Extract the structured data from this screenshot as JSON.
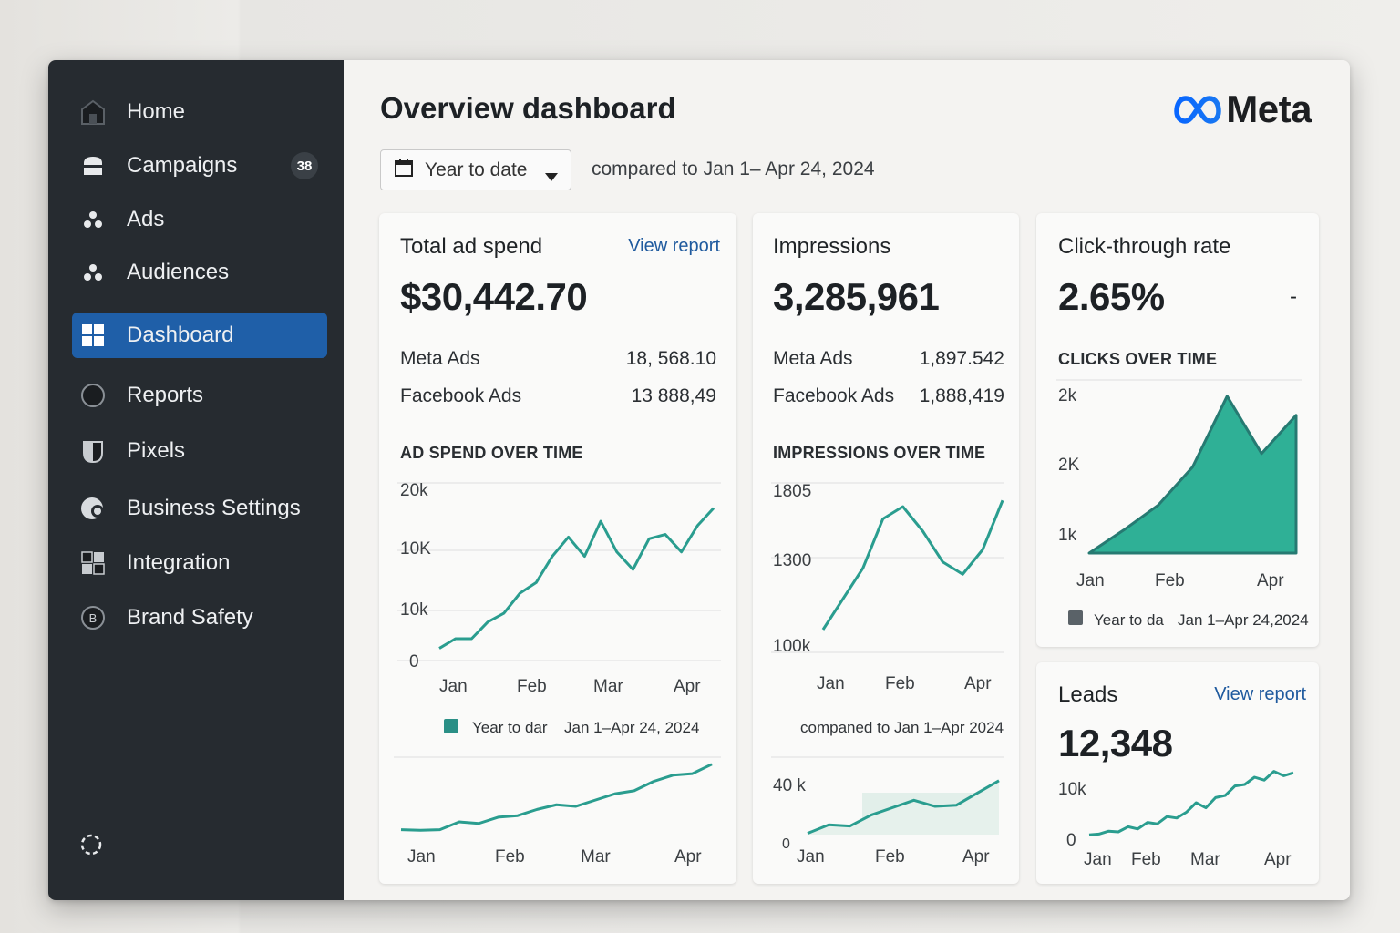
{
  "sidebar": {
    "items": [
      {
        "label": "Home",
        "icon": "home-icon"
      },
      {
        "label": "Campaigns",
        "icon": "campaigns-icon",
        "badge": "38"
      },
      {
        "label": "Ads",
        "icon": "ads-icon"
      },
      {
        "label": "Audiences",
        "icon": "audiences-icon"
      },
      {
        "label": "Dashboard",
        "icon": "dashboard-icon",
        "active": true
      },
      {
        "label": "Reports",
        "icon": "reports-icon"
      },
      {
        "label": "Pixels",
        "icon": "pixels-icon"
      },
      {
        "label": "Business Settings",
        "icon": "business-settings-icon"
      },
      {
        "label": "Integration",
        "icon": "integration-icon"
      },
      {
        "label": "Brand Safety",
        "icon": "brand-safety-icon"
      }
    ],
    "bottom_icon": "loading-icon"
  },
  "header": {
    "title": "Overview dashboard",
    "logo_text": "Meta",
    "date_select": "Year to date",
    "compare_text": "compared to Jan 1– Apr 24, 2024"
  },
  "colors": {
    "accent": "#2a9d8f",
    "sidebar_bg": "#262b30",
    "active_item": "#1f5fa8",
    "link": "#1f5a9e"
  },
  "cards": {
    "spend": {
      "title": "Total ad spend",
      "link": "View report",
      "value": "$30,442.70",
      "rows": [
        {
          "label": "Meta Ads",
          "value": "18, 568.10"
        },
        {
          "label": "Facebook Ads",
          "value": "13 888,49"
        }
      ],
      "chart_title": "AD SPEND OVER TIME",
      "legend_a": "Year to dar",
      "legend_b": "Jan 1–Apr 24, 2024"
    },
    "impressions": {
      "title": "Impressions",
      "value": "3,285,961",
      "rows": [
        {
          "label": "Meta Ads",
          "value": "1,897.542"
        },
        {
          "label": "Facebook Ads",
          "value": "1,888,419"
        }
      ],
      "chart_title": "IMPRESSIONS OVER TIME",
      "compare_note": "companed to Jan 1–Apr 2024"
    },
    "ctr": {
      "title": "Click-through rate",
      "value": "2.65%",
      "dash": "-",
      "chart_title": "CLICKS OVER TIME",
      "legend_a": "Year to da",
      "legend_b": "Jan 1–Apr 24,2024"
    },
    "leads": {
      "title": "Leads",
      "link": "View report",
      "value": "12,348"
    }
  },
  "chart_data": [
    {
      "type": "line",
      "title": "AD SPEND OVER TIME",
      "y_tick_labels": [
        "20k",
        "10K",
        "10k",
        "0"
      ],
      "x_tick_labels": [
        "Jan",
        "Feb",
        "Mar",
        "Apr"
      ],
      "series": [
        {
          "name": "Year to dar",
          "values": [
            1.5,
            2.6,
            2.6,
            4.5,
            5.5,
            7.8,
            9.0,
            12.0,
            14.2,
            12.0,
            16.0,
            12.5,
            10.5,
            14.0,
            14.5,
            12.5,
            15.5,
            17.5
          ]
        }
      ],
      "ylim": [
        0,
        21
      ]
    },
    {
      "type": "line",
      "title": "",
      "x_tick_labels": [
        "Jan",
        "Feb",
        "Mar",
        "Apr"
      ],
      "series": [
        {
          "values": [
            1.0,
            0.8,
            1.0,
            3.5,
            3.0,
            5.0,
            5.5,
            7.5,
            9.0,
            8.5,
            10.5,
            12.5,
            13.5,
            16.5,
            18.5,
            19.0,
            22.0
          ]
        }
      ],
      "ylim": [
        0,
        24
      ]
    },
    {
      "type": "line",
      "title": "IMPRESSIONS OVER TIME",
      "y_tick_labels": [
        "1805",
        "1300",
        "100k"
      ],
      "x_tick_labels": [
        "Jan",
        "Feb",
        "Apr"
      ],
      "series": [
        {
          "values": [
            2.0,
            4.5,
            7.0,
            11.0,
            12.0,
            10.0,
            7.5,
            6.5,
            8.5,
            12.5
          ]
        }
      ],
      "ylim": [
        0,
        16
      ]
    },
    {
      "type": "area",
      "title": "",
      "y_tick_labels": [
        "40 k",
        "0"
      ],
      "x_tick_labels": [
        "Jan",
        "Feb",
        "Apr"
      ],
      "series": [
        {
          "values": [
            0.5,
            4,
            3.5,
            8,
            11,
            14,
            11.5,
            12,
            17,
            22
          ]
        }
      ],
      "ylim": [
        0,
        26
      ]
    },
    {
      "type": "area",
      "title": "CLICKS OVER TIME",
      "y_tick_labels": [
        "2k",
        "2K",
        "1k"
      ],
      "x_tick_labels": [
        "Jan",
        "Feb",
        "Apr"
      ],
      "series": [
        {
          "name": "Year to da",
          "values": [
            0,
            1.2,
            2.5,
            4.5,
            8.2,
            5.2,
            7.2
          ]
        }
      ],
      "ylim": [
        0,
        9
      ]
    },
    {
      "type": "line",
      "title": "",
      "y_tick_labels": [
        "10k",
        "0"
      ],
      "x_tick_labels": [
        "Jan",
        "Feb",
        "Mar",
        "Apr"
      ],
      "series": [
        {
          "values": [
            0.1,
            0.2,
            0.6,
            0.5,
            1.2,
            0.9,
            1.8,
            1.6,
            2.6,
            2.4,
            3.2,
            4.5,
            3.8,
            5.2,
            5.5,
            6.8,
            7.0,
            8.0,
            7.6,
            8.8,
            8.2,
            8.6
          ]
        }
      ],
      "ylim": [
        0,
        10
      ]
    }
  ]
}
